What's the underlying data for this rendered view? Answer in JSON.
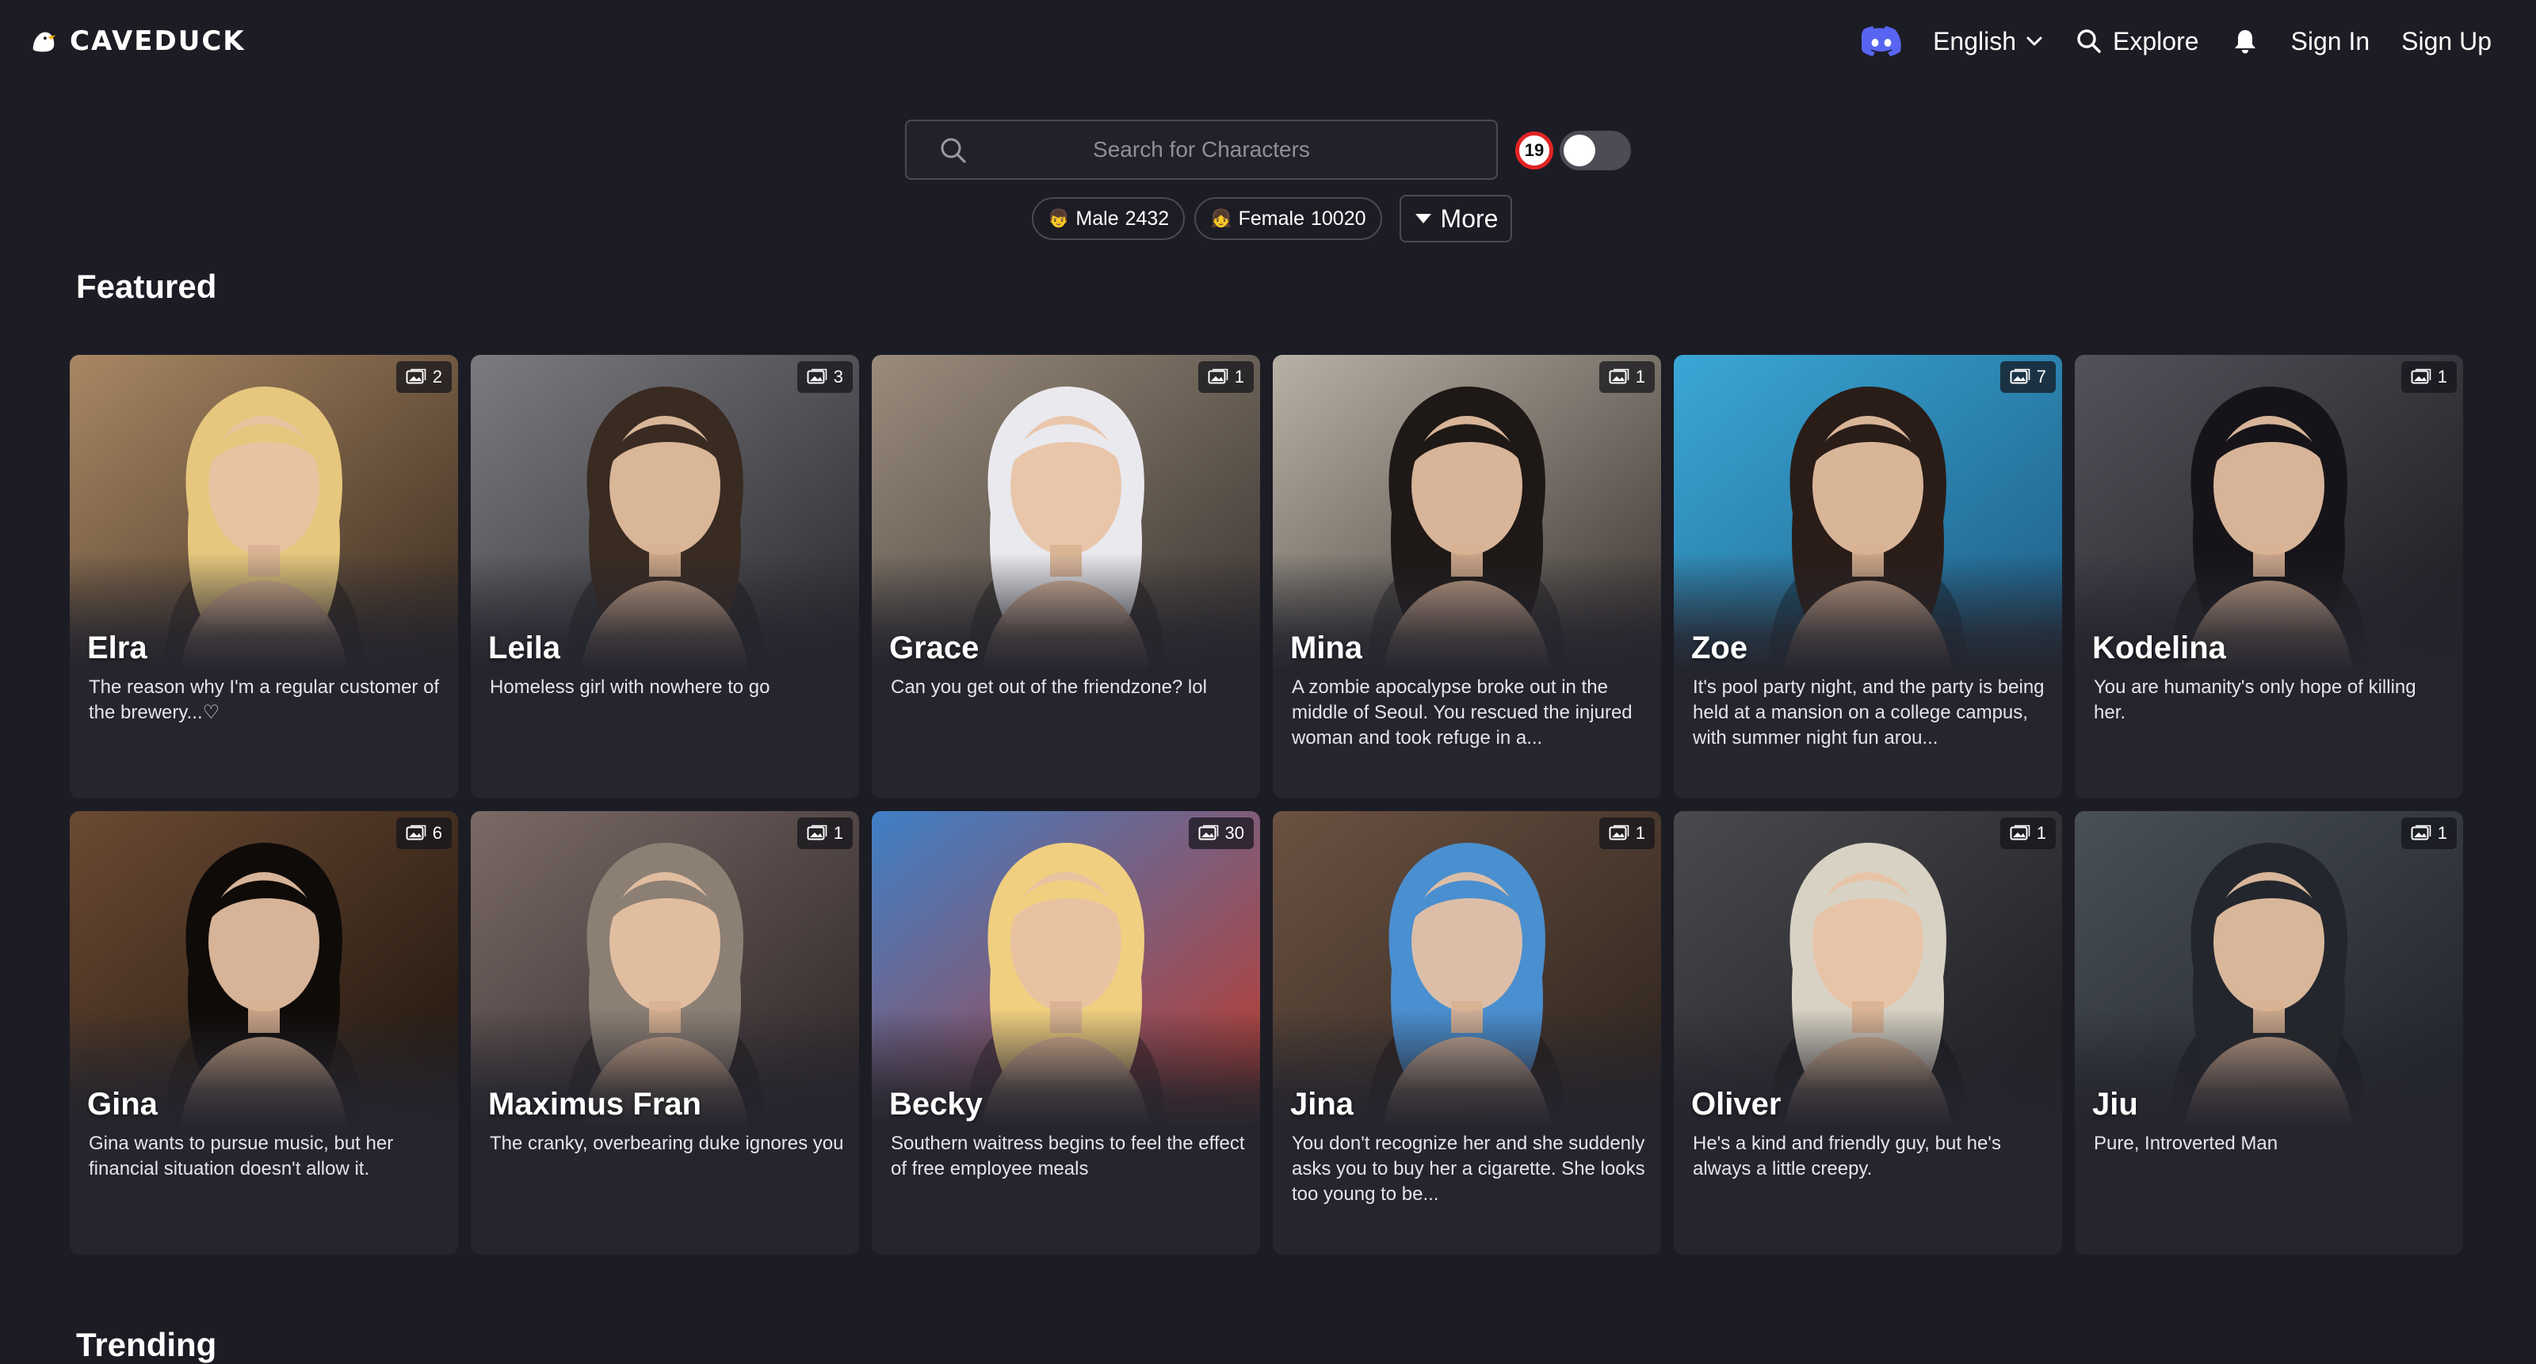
{
  "header": {
    "logo_text": "CAVEDUCK",
    "language": "English",
    "explore": "Explore",
    "sign_in": "Sign In",
    "sign_up": "Sign Up"
  },
  "search": {
    "placeholder": "Search for Characters",
    "age_badge": "19"
  },
  "filters": {
    "male_label": "Male",
    "male_count": "2432",
    "male_emoji": "👦",
    "female_label": "Female",
    "female_count": "10020",
    "female_emoji": "👧",
    "more_label": "More"
  },
  "sections": {
    "featured": "Featured",
    "trending": "Trending"
  },
  "colors": {
    "background": "#1c1c25",
    "card": "#25252e",
    "discord": "#5865F2",
    "age_ring": "#e02424"
  },
  "cards": [
    {
      "name": "Elra",
      "desc": "The reason why I'm a regular customer of the brewery...♡",
      "images": "2",
      "hue_a": "#a88763",
      "hue_b": "#3b2c20",
      "hair": "#e6c77d"
    },
    {
      "name": "Leila",
      "desc": "Homeless girl with nowhere to go",
      "images": "3",
      "hue_a": "#7c7c80",
      "hue_b": "#2a2a2e",
      "hair": "#3a2b22"
    },
    {
      "name": "Grace",
      "desc": "Can you get out of the friendzone? lol",
      "images": "1",
      "hue_a": "#9a8c7c",
      "hue_b": "#3a3430",
      "hair": "#e9e9ee"
    },
    {
      "name": "Mina",
      "desc": "A zombie apocalypse broke out in the middle of Seoul. You rescued the injured woman and took refuge in a...",
      "images": "1",
      "hue_a": "#b7b1a5",
      "hue_b": "#3b3430",
      "hair": "#1e1816"
    },
    {
      "name": "Zoe",
      "desc": "It's pool party night, and the party is being held at a mansion on a college campus, with summer night fun arou...",
      "images": "7",
      "hue_a": "#3aa7d6",
      "hue_b": "#1d5d86",
      "hair": "#2a1d18"
    },
    {
      "name": "Kodelina",
      "desc": "You are humanity's only hope of killing her.",
      "images": "1",
      "hue_a": "#55515a",
      "hue_b": "#1c1a20",
      "hair": "#161418"
    },
    {
      "name": "Gina",
      "desc": "Gina wants to pursue music, but her financial situation doesn't allow it.",
      "images": "6",
      "hue_a": "#6a4a32",
      "hue_b": "#1e140e",
      "hair": "#0f0b09"
    },
    {
      "name": "Maximus Fran",
      "desc": "The cranky, overbearing duke ignores you",
      "images": "1",
      "hue_a": "#7a6a66",
      "hue_b": "#2c2426",
      "hair": "#8c7f74"
    },
    {
      "name": "Becky",
      "desc": "Southern waitress begins to feel the effect of free employee meals",
      "images": "30",
      "hue_a": "#3f7fc6",
      "hue_b": "#c0392b",
      "hair": "#f0cf80"
    },
    {
      "name": "Jina",
      "desc": "You don't recognize her and she suddenly asks you to buy her a cigarette. She looks too young to be...",
      "images": "1",
      "hue_a": "#6b5242",
      "hue_b": "#2c221c",
      "hair": "#4a8fd0"
    },
    {
      "name": "Oliver",
      "desc": "He's a kind and friendly guy, but he's always a little creepy.",
      "images": "1",
      "hue_a": "#4a4a4e",
      "hue_b": "#1c1c20",
      "hair": "#d8d2c4"
    },
    {
      "name": "Jiu",
      "desc": "Pure, Introverted Man",
      "images": "1",
      "hue_a": "#4a5058",
      "hue_b": "#1e2228",
      "hair": "#23262c"
    }
  ]
}
